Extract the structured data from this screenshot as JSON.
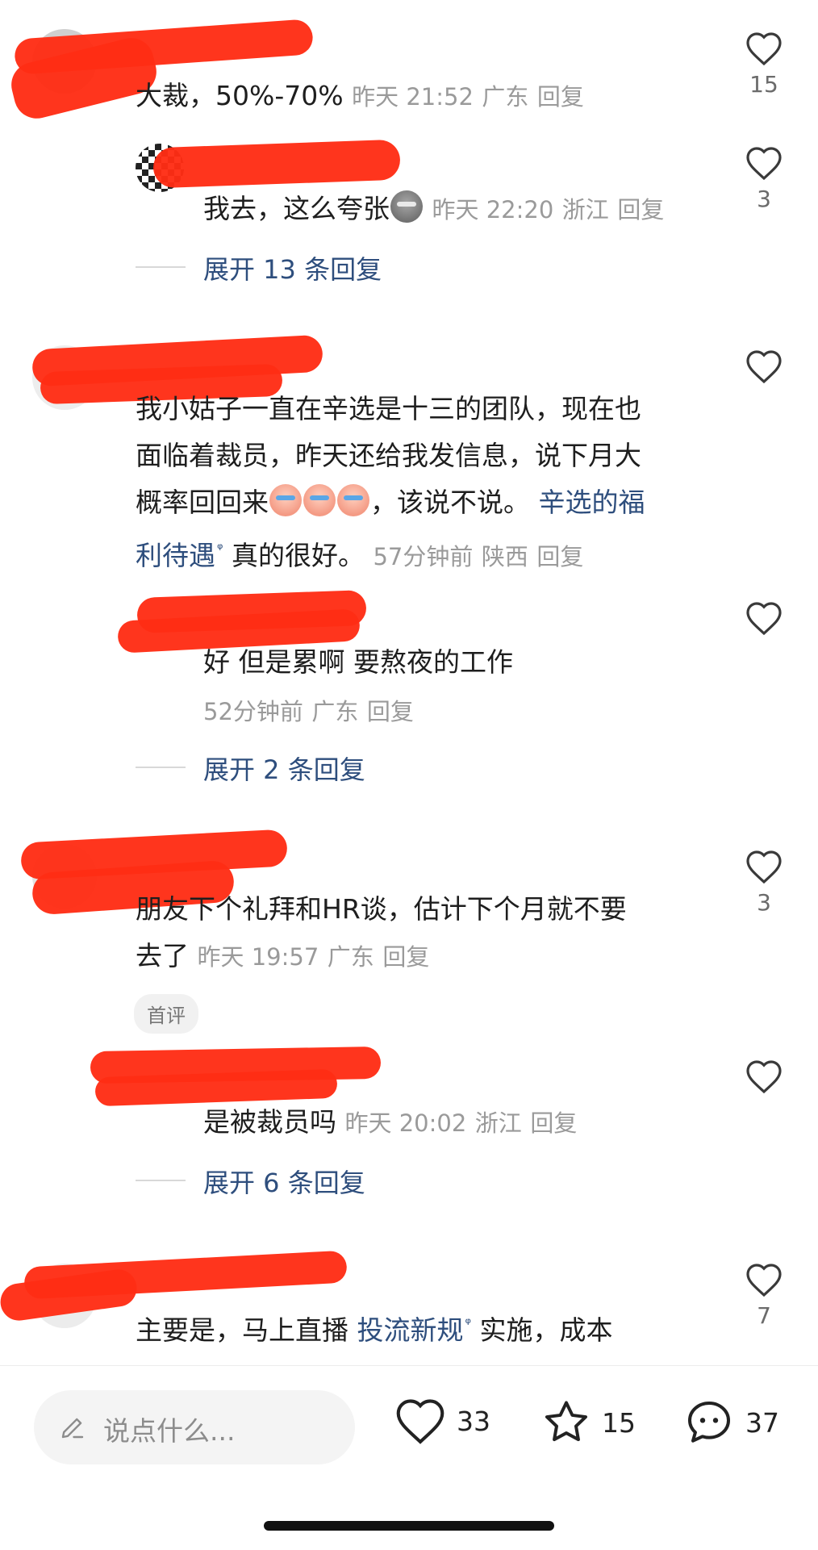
{
  "comments": [
    {
      "text": "大裁，50%-70%",
      "time": "昨天 21:52",
      "location": "广东",
      "reply_label": "回复",
      "likes": "15"
    },
    {
      "text": "我去，这么夸张",
      "time": "昨天 22:20",
      "location": "浙江",
      "reply_label": "回复",
      "likes": "3",
      "expand": "展开 13 条回复"
    },
    {
      "text_lines": [
        "我小姑子一直在辛选是十三的团队，现在也",
        "面临着裁员，昨天还给我发信息，说下月大",
        "概率回回来"
      ],
      "text_tail": "，该说不说。",
      "link_1": "辛选的福",
      "link_2": "利待遇",
      "text_after_link": "真的很好。",
      "time": "57分钟前",
      "location": "陕西",
      "reply_label": "回复",
      "likes": ""
    },
    {
      "text": "好 但是累啊 要熬夜的工作",
      "time": "52分钟前",
      "location": "广东",
      "reply_label": "回复",
      "likes": "",
      "expand": "展开 2 条回复"
    },
    {
      "text_lines": [
        "朋友下个礼拜和HR谈，估计下个月就不要",
        "去了"
      ],
      "time": "昨天 19:57",
      "location": "广东",
      "reply_label": "回复",
      "likes": "3",
      "tag": "首评"
    },
    {
      "text": "是被裁员吗",
      "time": "昨天 20:02",
      "location": "浙江",
      "reply_label": "回复",
      "likes": "",
      "expand": "展开 6 条回复"
    },
    {
      "text_start": "主要是，马上直播",
      "link": "投流新规",
      "text_end": "实施，成本",
      "likes": "7"
    }
  ],
  "bottom_bar": {
    "input_placeholder": "说点什么...",
    "like_count": "33",
    "star_count": "15",
    "comment_count": "37"
  }
}
